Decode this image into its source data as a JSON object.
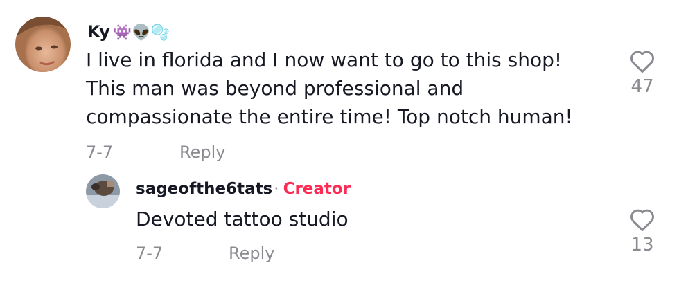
{
  "comment": {
    "username": "Ky",
    "username_emojis": "👾👽🫧",
    "text_lines": [
      "I live in florida and I now want to go to this shop!",
      "This man was beyond professional and",
      "compassionate the entire time! Top notch human!"
    ],
    "date": "7-7",
    "reply_label": "Reply",
    "like_count": "47",
    "avatar_icon": "profile-photo"
  },
  "reply": {
    "username": "sageofthe6tats",
    "separator": "·",
    "badge": "Creator",
    "text": "Devoted tattoo studio",
    "date": "7-7",
    "reply_label": "Reply",
    "like_count": "13",
    "avatar_icon": "profile-photo"
  },
  "colors": {
    "text_primary": "#161823",
    "text_secondary": "#8a8b91",
    "creator_badge": "#fe2c55",
    "heart_outline": "#8a8b91"
  }
}
